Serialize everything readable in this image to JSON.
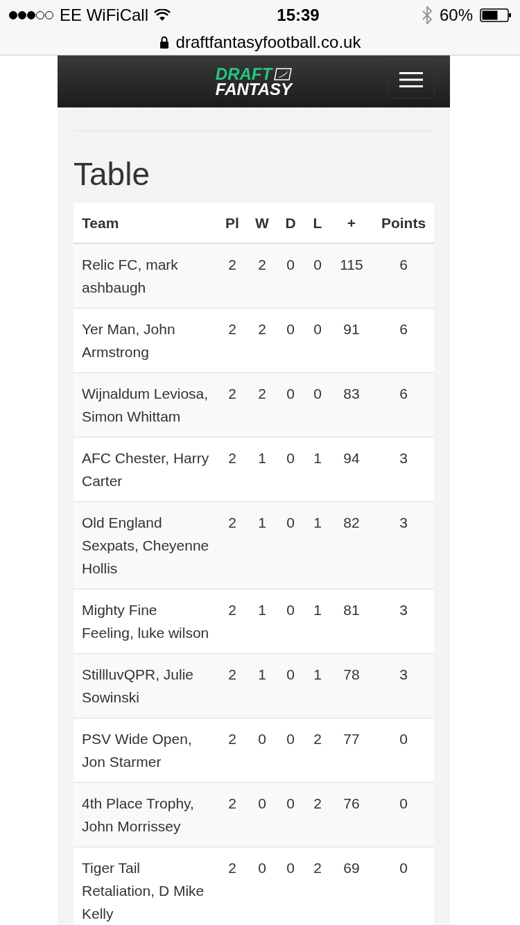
{
  "status_bar": {
    "carrier": "EE WiFiCall",
    "time": "15:39",
    "battery": "60%"
  },
  "address_bar": {
    "url": "draftfantasyfootball.co.uk"
  },
  "header": {
    "logo_top": "DRAFT",
    "logo_bottom": "FANTASY"
  },
  "section": {
    "title": "Table"
  },
  "table": {
    "columns": [
      "Team",
      "Pl",
      "W",
      "D",
      "L",
      "+",
      "Points"
    ],
    "rows": [
      [
        "Relic FC, mark ashbaugh",
        "2",
        "2",
        "0",
        "0",
        "115",
        "6"
      ],
      [
        "Yer Man, John Armstrong",
        "2",
        "2",
        "0",
        "0",
        "91",
        "6"
      ],
      [
        "Wijnaldum Leviosa, Simon Whittam",
        "2",
        "2",
        "0",
        "0",
        "83",
        "6"
      ],
      [
        "AFC Chester, Harry Carter",
        "2",
        "1",
        "0",
        "1",
        "94",
        "3"
      ],
      [
        "Old England Sexpats, Cheyenne Hollis",
        "2",
        "1",
        "0",
        "1",
        "82",
        "3"
      ],
      [
        "Mighty Fine Feeling, luke wilson",
        "2",
        "1",
        "0",
        "1",
        "81",
        "3"
      ],
      [
        "StillluvQPR, Julie Sowinski",
        "2",
        "1",
        "0",
        "1",
        "78",
        "3"
      ],
      [
        "PSV Wide Open, Jon Starmer",
        "2",
        "0",
        "0",
        "2",
        "77",
        "0"
      ],
      [
        "4th Place Trophy, John Morrissey",
        "2",
        "0",
        "0",
        "2",
        "76",
        "0"
      ],
      [
        "Tiger Tail Retaliation, D Mike Kelly",
        "2",
        "0",
        "0",
        "2",
        "69",
        "0"
      ]
    ]
  }
}
